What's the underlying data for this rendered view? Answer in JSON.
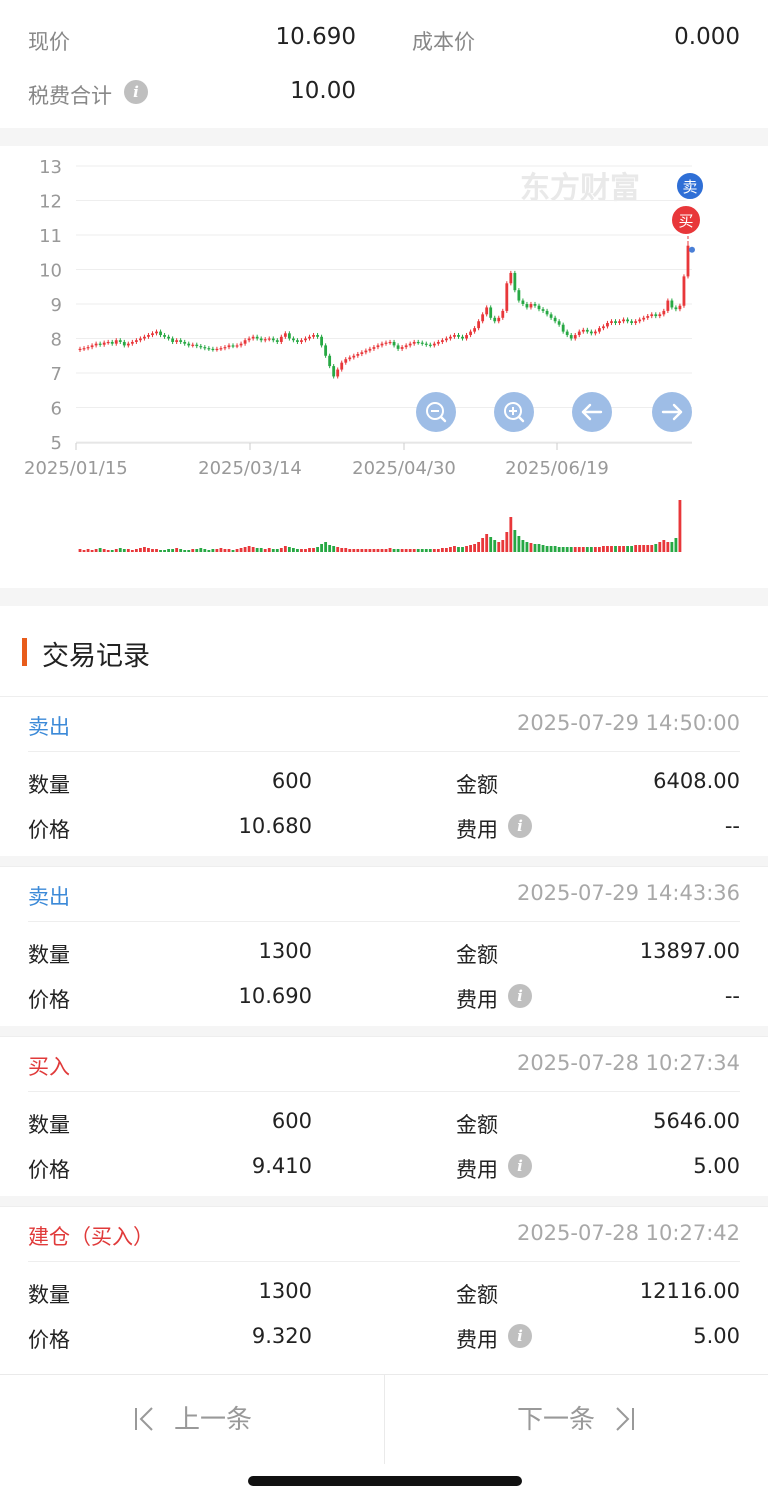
{
  "summary": {
    "current_price_label": "现价",
    "current_price": "10.690",
    "cost_price_label": "成本价",
    "cost_price": "0.000",
    "fee_total_label": "税费合计",
    "fee_total": "10.00"
  },
  "chart": {
    "watermark": "东方财富",
    "sell_marker": "卖",
    "buy_marker": "买",
    "zoom_out_icon": "zoom-out-icon",
    "zoom_in_icon": "zoom-in-icon",
    "prev_icon": "arrow-left-icon",
    "next_icon": "arrow-right-icon",
    "colors": {
      "up": "#e8373a",
      "down": "#27a844",
      "grid": "#eeeeee",
      "axis": "#999999",
      "button": "#9ebde6"
    }
  },
  "chart_data": {
    "type": "candlestick",
    "y_ticks": [
      "13",
      "12",
      "11",
      "10",
      "9",
      "8",
      "7",
      "6",
      "5"
    ],
    "ylim": [
      5,
      13
    ],
    "x_labels": [
      "2025/01/15",
      "2025/03/14",
      "2025/04/30",
      "2025/06/19"
    ],
    "close": [
      7.7,
      7.72,
      7.75,
      7.8,
      7.85,
      7.82,
      7.88,
      7.9,
      7.85,
      7.95,
      7.9,
      7.8,
      7.85,
      7.9,
      7.95,
      8.0,
      8.05,
      8.1,
      8.15,
      8.2,
      8.1,
      8.05,
      8.0,
      7.9,
      7.95,
      7.9,
      7.85,
      7.8,
      7.82,
      7.78,
      7.75,
      7.72,
      7.7,
      7.68,
      7.7,
      7.72,
      7.75,
      7.8,
      7.78,
      7.8,
      7.85,
      7.95,
      8.0,
      8.05,
      8.0,
      7.95,
      7.98,
      8.0,
      7.95,
      7.9,
      8.05,
      8.15,
      8.0,
      7.95,
      7.9,
      7.95,
      8.0,
      8.05,
      8.1,
      8.05,
      7.8,
      7.5,
      7.2,
      6.9,
      7.1,
      7.3,
      7.4,
      7.45,
      7.5,
      7.55,
      7.6,
      7.65,
      7.7,
      7.75,
      7.8,
      7.85,
      7.88,
      7.9,
      7.8,
      7.7,
      7.75,
      7.8,
      7.85,
      7.9,
      7.88,
      7.85,
      7.82,
      7.8,
      7.85,
      7.9,
      7.95,
      8.0,
      8.05,
      8.1,
      8.05,
      8.0,
      8.1,
      8.2,
      8.3,
      8.5,
      8.7,
      8.9,
      8.6,
      8.5,
      8.6,
      8.8,
      9.6,
      9.9,
      9.4,
      9.1,
      9.0,
      8.9,
      9.0,
      8.95,
      8.85,
      8.8,
      8.7,
      8.6,
      8.5,
      8.4,
      8.2,
      8.1,
      8.0,
      8.1,
      8.2,
      8.25,
      8.2,
      8.15,
      8.2,
      8.3,
      8.35,
      8.45,
      8.5,
      8.45,
      8.5,
      8.55,
      8.5,
      8.45,
      8.5,
      8.55,
      8.6,
      8.65,
      8.7,
      8.65,
      8.7,
      8.8,
      9.1,
      8.9,
      8.85,
      8.95,
      9.8,
      10.69
    ],
    "volume": [
      3,
      2,
      3,
      2,
      3,
      4,
      3,
      2,
      2,
      3,
      4,
      3,
      3,
      2,
      3,
      4,
      5,
      4,
      3,
      3,
      2,
      2,
      3,
      3,
      4,
      3,
      2,
      2,
      3,
      3,
      4,
      3,
      2,
      3,
      3,
      4,
      3,
      3,
      2,
      3,
      4,
      5,
      6,
      5,
      4,
      4,
      3,
      4,
      3,
      3,
      4,
      6,
      5,
      4,
      3,
      3,
      3,
      4,
      4,
      5,
      8,
      10,
      7,
      6,
      5,
      4,
      4,
      3,
      3,
      3,
      3,
      3,
      3,
      3,
      3,
      3,
      3,
      4,
      3,
      3,
      3,
      3,
      3,
      3,
      3,
      3,
      3,
      3,
      3,
      3,
      4,
      4,
      5,
      6,
      5,
      5,
      6,
      7,
      8,
      10,
      14,
      18,
      15,
      12,
      10,
      12,
      20,
      35,
      22,
      16,
      12,
      10,
      9,
      8,
      8,
      7,
      6,
      6,
      6,
      5,
      5,
      5,
      5,
      5,
      5,
      5,
      5,
      5,
      5,
      5,
      6,
      6,
      6,
      6,
      6,
      6,
      6,
      6,
      7,
      7,
      7,
      7,
      7,
      8,
      10,
      12,
      10,
      10,
      14,
      52
    ],
    "buy_signal_value": 10.69,
    "sell_signal_value": 10.69
  },
  "records": {
    "title": "交易记录",
    "items": [
      {
        "type": "卖出",
        "kind": "sell",
        "time": "2025-07-29 14:50:00",
        "qty_label": "数量",
        "qty": "600",
        "amount_label": "金额",
        "amount": "6408.00",
        "price_label": "价格",
        "price": "10.680",
        "fee_label": "费用",
        "fee": "--"
      },
      {
        "type": "卖出",
        "kind": "sell",
        "time": "2025-07-29 14:43:36",
        "qty_label": "数量",
        "qty": "1300",
        "amount_label": "金额",
        "amount": "13897.00",
        "price_label": "价格",
        "price": "10.690",
        "fee_label": "费用",
        "fee": "--"
      },
      {
        "type": "买入",
        "kind": "buy",
        "time": "2025-07-28 10:27:34",
        "qty_label": "数量",
        "qty": "600",
        "amount_label": "金额",
        "amount": "5646.00",
        "price_label": "价格",
        "price": "9.410",
        "fee_label": "费用",
        "fee": "5.00"
      },
      {
        "type": "建仓（买入）",
        "kind": "buy",
        "time": "2025-07-28 10:27:42",
        "qty_label": "数量",
        "qty": "1300",
        "amount_label": "金额",
        "amount": "12116.00",
        "price_label": "价格",
        "price": "9.320",
        "fee_label": "费用",
        "fee": "5.00"
      }
    ]
  },
  "nav": {
    "prev_label": "上一条",
    "next_label": "下一条",
    "prev_icon": "prev-bar-icon",
    "next_icon": "next-bar-icon"
  }
}
